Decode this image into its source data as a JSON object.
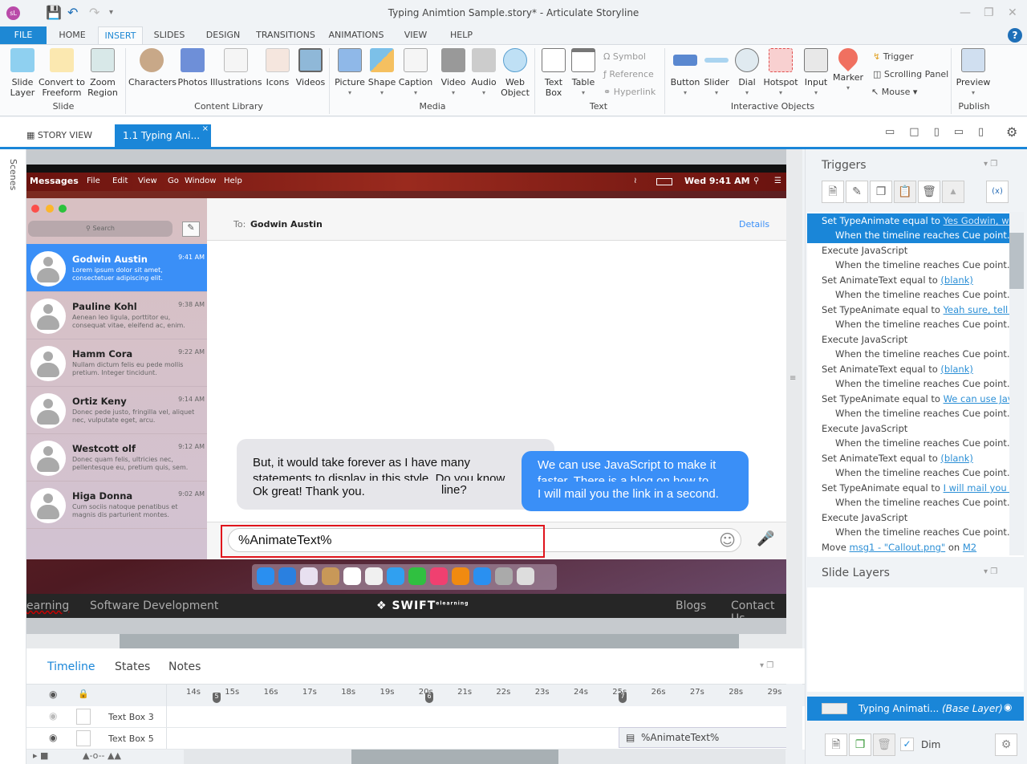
{
  "window": {
    "title": "Typing Animtion Sample.story* -  Articulate Storyline",
    "logo": "sL"
  },
  "menu_tabs": [
    "FILE",
    "HOME",
    "INSERT",
    "SLIDES",
    "DESIGN",
    "TRANSITIONS",
    "ANIMATIONS",
    "VIEW",
    "HELP"
  ],
  "ribbon": {
    "slide": {
      "label": "Slide",
      "buttons": [
        "Slide\nLayer",
        "Convert to\nFreeform",
        "Zoom\nRegion"
      ]
    },
    "content_library": {
      "label": "Content Library",
      "buttons": [
        "Characters",
        "Photos",
        "Illustrations",
        "Icons",
        "Videos"
      ]
    },
    "media": {
      "label": "Media",
      "buttons": [
        "Picture",
        "Shape",
        "Caption",
        "Video",
        "Audio",
        "Web\nObject"
      ]
    },
    "text": {
      "label": "Text",
      "buttons": [
        "Text\nBox",
        "Table"
      ],
      "small": [
        "Symbol",
        "Reference",
        "Hyperlink"
      ]
    },
    "interactive": {
      "label": "Interactive Objects",
      "buttons": [
        "Button",
        "Slider",
        "Dial",
        "Hotspot",
        "Input",
        "Marker"
      ],
      "small": [
        "Trigger",
        "Scrolling Panel",
        "Mouse"
      ]
    },
    "publish": {
      "label": "Publish",
      "buttons": [
        "Preview"
      ]
    }
  },
  "view_tabs": {
    "story_view": "STORY VIEW",
    "active": "1.1 Typing Ani..."
  },
  "scenes_label": "Scenes",
  "slide": {
    "menubar": {
      "app": "Messages",
      "items": [
        "File",
        "Edit",
        "View",
        "Go",
        "Window",
        "Help"
      ],
      "clock": "Wed 9:41 AM"
    },
    "search_placeholder": "Search",
    "to_label": "To:",
    "to_name": "Godwin Austin",
    "details": "Details",
    "conversations": [
      {
        "name": "Godwin Austin",
        "time": "9:41 AM",
        "preview": "Lorem ipsum dolor sit amet, consectetuer adipiscing elit."
      },
      {
        "name": "Pauline Kohl",
        "time": "9:38 AM",
        "preview": "Aenean leo ligula, porttitor eu, consequat vitae, eleifend ac, enim."
      },
      {
        "name": "Hamm Cora",
        "time": "9:22 AM",
        "preview": "Nullam dictum felis eu pede mollis pretium. Integer tincidunt."
      },
      {
        "name": "Ortiz Keny",
        "time": "9:14 AM",
        "preview": "Donec pede justo, fringilla vel, aliquet nec, vulputate eget, arcu."
      },
      {
        "name": "Westcott olf",
        "time": "9:12 AM",
        "preview": "Donec quam felis, ultricies nec, pellentesque eu, pretium quis, sem."
      },
      {
        "name": "Higa Donna",
        "time": "9:02 AM",
        "preview": "Cum sociis natoque penatibus et magnis dis parturient montes."
      }
    ],
    "bubble_gray": {
      "line1": "But, it would take forever as I have many",
      "line2": "statements to display in this style. Do you know",
      "line3": "Ok great! Thank you.",
      "fragment": "line?"
    },
    "bubble_blue": {
      "line1": "We can use JavaScript to make it",
      "line2": "faster. There is a blog on how to",
      "line3": "I will mail you the link in a second."
    },
    "input_text": "%AnimateText%",
    "footer": {
      "left1": "earning",
      "left2": "Software Development",
      "brand": "SWIFT",
      "brand_sup": "elearning",
      "right1": "Blogs",
      "right2": "Contact Us"
    }
  },
  "timeline": {
    "tabs": [
      "Timeline",
      "States",
      "Notes"
    ],
    "ticks": [
      "14s",
      "15s",
      "16s",
      "17s",
      "18s",
      "19s",
      "20s",
      "21s",
      "22s",
      "23s",
      "24s",
      "25s",
      "26s",
      "27s",
      "28s",
      "29s"
    ],
    "cue_points": [
      "5",
      "6",
      "7"
    ],
    "rows": [
      {
        "name": "Text Box 3"
      },
      {
        "name": "Text Box 5",
        "bar": "%AnimateText%"
      }
    ]
  },
  "triggers": {
    "title": "Triggers",
    "items": [
      {
        "action": "Set TypeAnimate equal to ",
        "link": "Yes Godwin, what",
        "when": "When the timeline reaches Cue point..."
      },
      {
        "action": "Execute JavaScript",
        "link": "",
        "when": "When the timeline reaches Cue point..."
      },
      {
        "action": "Set AnimateText equal to ",
        "link": "(blank)",
        "when": "When the timeline reaches Cue point..."
      },
      {
        "action": "Set TypeAnimate equal to ",
        "link": "Yeah sure, tell me.",
        "when": "When the timeline reaches Cue point..."
      },
      {
        "action": "Execute JavaScript",
        "link": "",
        "when": "When the timeline reaches Cue point..."
      },
      {
        "action": "Set AnimateText equal to ",
        "link": "(blank)",
        "when": "When the timeline reaches Cue point..."
      },
      {
        "action": "Set TypeAnimate equal to ",
        "link": "We can use JavaSc",
        "when": "When the timeline reaches Cue point..."
      },
      {
        "action": "Execute JavaScript",
        "link": "",
        "when": "When the timeline reaches Cue point..."
      },
      {
        "action": "Set AnimateText equal to ",
        "link": "(blank)",
        "when": "When the timeline reaches Cue point..."
      },
      {
        "action": "Set TypeAnimate equal to ",
        "link": "I will mail you the",
        "when": "When the timeline reaches Cue point..."
      },
      {
        "action": "Execute JavaScript",
        "link": "",
        "when": "When the timeline reaches Cue point..."
      }
    ],
    "last": {
      "action": "Move ",
      "link": "msg1 - \"Callout.png\"",
      "mid": " on ",
      "link2": "M2"
    }
  },
  "slide_layers": {
    "title": "Slide Layers",
    "base": {
      "name": "Typing Animati...",
      "tag": "(Base Layer)"
    },
    "dim_label": "Dim",
    "dim_checked": true
  },
  "colors": {
    "accent": "#1a86d8",
    "bubble_blue": "#3a8ff7",
    "input_outline": "#e0141c"
  }
}
